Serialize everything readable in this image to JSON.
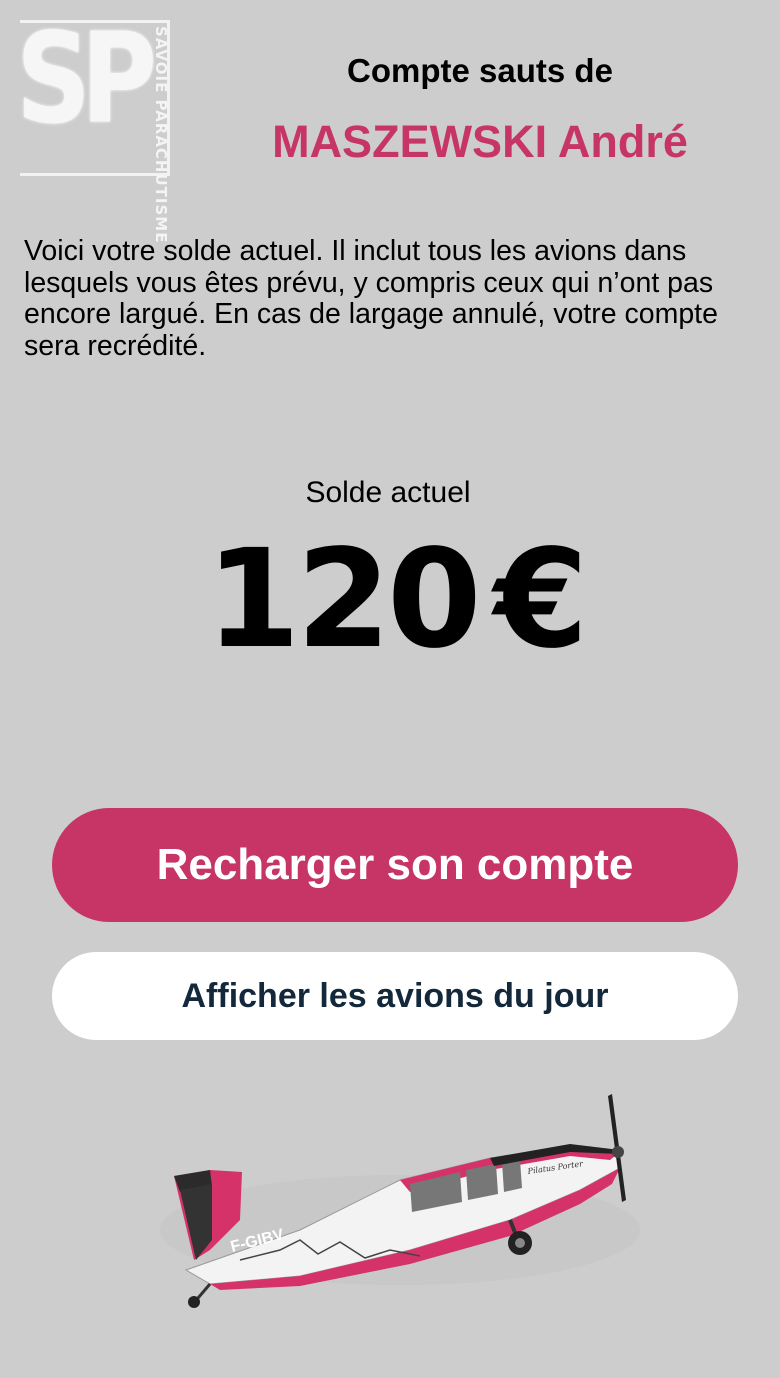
{
  "logo": {
    "letters": "SP",
    "side_text": "SAVOIE PARACHUTISME"
  },
  "header": {
    "title": "Compte sauts de",
    "name": "MASZEWSKI André"
  },
  "intro_text": "Voici votre solde actuel. Il inclut tous les avions dans lesquels vous êtes prévu, y compris ceux qui n’ont pas encore largué. En cas de largage annulé, votre compte sera recrédité.",
  "balance": {
    "label": "Solde actuel",
    "amount": "120",
    "currency": "€"
  },
  "buttons": {
    "recharge": "Recharger son compte",
    "flights": "Afficher les avions du jour"
  },
  "plane": {
    "registration": "F-GIBV",
    "script_name": "Pilatus Porter"
  },
  "colors": {
    "accent": "#c63565",
    "background": "#cdcdcd",
    "secondary_text": "#13283a"
  }
}
